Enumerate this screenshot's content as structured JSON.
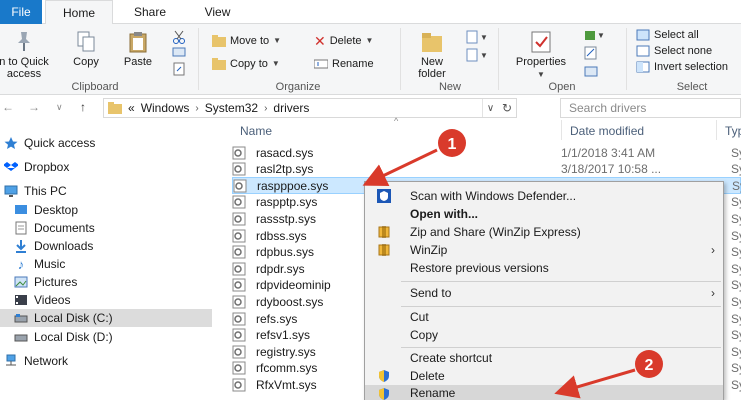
{
  "ribbon_tabs": {
    "file": "File",
    "home": "Home",
    "share": "Share",
    "view": "View"
  },
  "ribbon": {
    "pin_label_1": "n to Quick",
    "pin_label_2": "access",
    "copy": "Copy",
    "paste": "Paste",
    "clipboard_group": "Clipboard",
    "move_to": "Move to",
    "copy_to": "Copy to",
    "delete": "Delete",
    "rename": "Rename",
    "organize_group": "Organize",
    "new_folder_1": "New",
    "new_folder_2": "folder",
    "new_group": "New",
    "properties": "Properties",
    "open_group": "Open",
    "select_all": "Select all",
    "select_none": "Select none",
    "invert_selection": "Invert selection",
    "select_group": "Select"
  },
  "address": {
    "prefix": "«",
    "crumbs": [
      "Windows",
      "System32",
      "drivers"
    ],
    "search_placeholder": "Search drivers"
  },
  "nav": {
    "items": [
      {
        "label": "Quick access",
        "icon": "star-icon"
      },
      {
        "label": "Dropbox",
        "icon": "dropbox-icon"
      },
      {
        "label": "This PC",
        "icon": "computer-icon"
      },
      {
        "label": "Desktop",
        "icon": "desktop-icon"
      },
      {
        "label": "Documents",
        "icon": "documents-icon"
      },
      {
        "label": "Downloads",
        "icon": "downloads-icon"
      },
      {
        "label": "Music",
        "icon": "music-icon"
      },
      {
        "label": "Pictures",
        "icon": "pictures-icon"
      },
      {
        "label": "Videos",
        "icon": "videos-icon"
      },
      {
        "label": "Local Disk (C:)",
        "icon": "drive-icon"
      },
      {
        "label": "Local Disk (D:)",
        "icon": "drive-icon"
      },
      {
        "label": "Network",
        "icon": "network-icon"
      }
    ]
  },
  "files": {
    "columns": {
      "name": "Name",
      "date": "Date modified",
      "type": "Typ"
    },
    "rows": [
      {
        "name": "rasacd.sys",
        "date": "1/1/2018 3:41 AM",
        "type": "Sy"
      },
      {
        "name": "rasl2tp.sys",
        "date": "3/18/2017 10:58 ...",
        "type": "Sy"
      },
      {
        "name": "raspppoe.sys",
        "date": "3/18/2017 10:57 ...",
        "type": "Sy"
      },
      {
        "name": "raspptp.sys",
        "date": "",
        "type": "Sy"
      },
      {
        "name": "rassstp.sys",
        "date": "",
        "type": "Sy"
      },
      {
        "name": "rdbss.sys",
        "date": "",
        "type": "Sy"
      },
      {
        "name": "rdpbus.sys",
        "date": "",
        "type": "Sy"
      },
      {
        "name": "rdpdr.sys",
        "date": "",
        "type": "Sy"
      },
      {
        "name": "rdpvideominip",
        "date": "",
        "type": "Sy"
      },
      {
        "name": "rdyboost.sys",
        "date": "",
        "type": "Sy"
      },
      {
        "name": "refs.sys",
        "date": "",
        "type": "Sy"
      },
      {
        "name": "refsv1.sys",
        "date": "",
        "type": "Sy"
      },
      {
        "name": "registry.sys",
        "date": "",
        "type": "Sy"
      },
      {
        "name": "rfcomm.sys",
        "date": "",
        "type": "Sy"
      },
      {
        "name": "RfxVmt.sys",
        "date": "",
        "type": "Sy"
      }
    ]
  },
  "context_menu": {
    "items": [
      {
        "label": "Scan with Windows Defender...",
        "icon": "defender-icon"
      },
      {
        "label": "Open with...",
        "icon": ""
      },
      {
        "label": "Zip and Share (WinZip Express)",
        "icon": "winzip-icon"
      },
      {
        "label": "WinZip",
        "icon": "winzip-icon"
      },
      {
        "label": "Restore previous versions",
        "icon": ""
      },
      {
        "label": "Send to",
        "icon": ""
      },
      {
        "label": "Cut",
        "icon": ""
      },
      {
        "label": "Copy",
        "icon": ""
      },
      {
        "label": "Create shortcut",
        "icon": ""
      },
      {
        "label": "Delete",
        "icon": "uac-shield-icon"
      },
      {
        "label": "Rename",
        "icon": "uac-shield-icon"
      }
    ]
  },
  "annotations": {
    "badge1": "1",
    "badge2": "2",
    "color": "#d93a2b"
  }
}
